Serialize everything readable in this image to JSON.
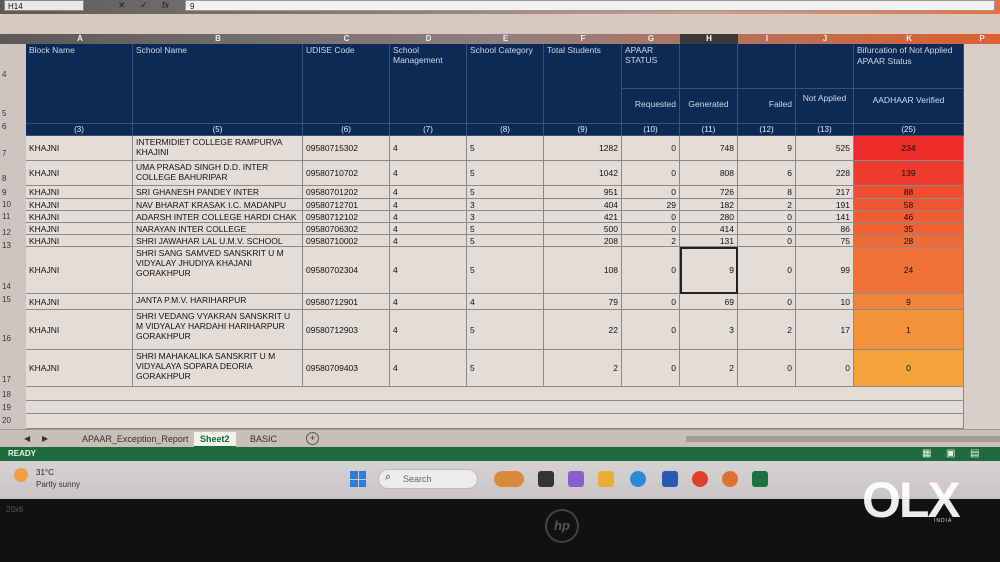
{
  "formula_bar": {
    "name_box": "H14",
    "cancel_glyph": "✕",
    "enter_glyph": "✓",
    "fx_glyph": "fx",
    "formula_value": "9"
  },
  "columns": [
    {
      "letter": "A"
    },
    {
      "letter": "B"
    },
    {
      "letter": "C"
    },
    {
      "letter": "D"
    },
    {
      "letter": "E"
    },
    {
      "letter": "F"
    },
    {
      "letter": "G"
    },
    {
      "letter": "H"
    },
    {
      "letter": "I"
    },
    {
      "letter": "J"
    },
    {
      "letter": "K"
    },
    {
      "letter": "P"
    }
  ],
  "header": {
    "block_name": "Block Name",
    "school_name": "School Name",
    "udise_code": "UDISE Code",
    "school_management": "School Management",
    "school_category": "School Category",
    "total_students": "Total Students",
    "apaar_status": "APAAR STATUS",
    "requested": "Requested",
    "generated": "Generated",
    "failed": "Failed",
    "not_applied": "Not Applied",
    "bifurcation": "Bifurcation of Not Applied APAAR Status",
    "aadhaar_verified": "AADHAAR Verified"
  },
  "header_numbers": [
    "(3)",
    "(5)",
    "(6)",
    "(7)",
    "(8)",
    "(9)",
    "(10)",
    "(11)",
    "(12)",
    "(13)",
    "(25)"
  ],
  "row_numbers": [
    "4",
    "5",
    "6",
    "7",
    "8",
    "9",
    "10",
    "11",
    "12",
    "13",
    "14",
    "15",
    "16",
    "17",
    "18",
    "19",
    "20"
  ],
  "rows": [
    {
      "block": "KHAJNI",
      "school": "INTERMIDIET COLLEGE RAMPURVA KHAJINI",
      "udise": "09580715302",
      "mgmt": "4",
      "cat": "5",
      "total": "1282",
      "requested": "0",
      "generated": "748",
      "failed": "9",
      "not_applied": "525",
      "aadhaar": "234",
      "color": "#ee2a2a"
    },
    {
      "block": "KHAJNI",
      "school": "UMA PRASAD SINGH D.D. INTER COLLEGE BAHURIPAR",
      "udise": "09580710702",
      "mgmt": "4",
      "cat": "5",
      "total": "1042",
      "requested": "0",
      "generated": "808",
      "failed": "6",
      "not_applied": "228",
      "aadhaar": "139",
      "color": "#ef3b2e"
    },
    {
      "block": "KHAJNI",
      "school": "SRI GHANESH PANDEY INTER COLLEGE",
      "udise": "09580701202",
      "mgmt": "4",
      "cat": "5",
      "total": "951",
      "requested": "0",
      "generated": "726",
      "failed": "8",
      "not_applied": "217",
      "aadhaar": "88",
      "color": "#ef4d30"
    },
    {
      "block": "KHAJNI",
      "school": "NAV BHARAT KRASAK I.C. MADANPU",
      "udise": "09580712701",
      "mgmt": "4",
      "cat": "3",
      "total": "404",
      "requested": "29",
      "generated": "182",
      "failed": "2",
      "not_applied": "191",
      "aadhaar": "58",
      "color": "#f05532"
    },
    {
      "block": "KHAJNI",
      "school": "ADARSH INTER COLLEGE HARDI CHAK",
      "udise": "09580712102",
      "mgmt": "4",
      "cat": "3",
      "total": "421",
      "requested": "0",
      "generated": "280",
      "failed": "0",
      "not_applied": "141",
      "aadhaar": "46",
      "color": "#f05c33"
    },
    {
      "block": "KHAJNI",
      "school": "NARAYAN INTER COLLEGE",
      "udise": "09580706302",
      "mgmt": "4",
      "cat": "5",
      "total": "500",
      "requested": "0",
      "generated": "414",
      "failed": "0",
      "not_applied": "86",
      "aadhaar": "35",
      "color": "#f06234"
    },
    {
      "block": "KHAJNI",
      "school": "SHRI JAWAHAR LAL U.M.V. SCHOOL",
      "udise": "09580710002",
      "mgmt": "4",
      "cat": "5",
      "total": "208",
      "requested": "2",
      "generated": "131",
      "failed": "0",
      "not_applied": "75",
      "aadhaar": "28",
      "color": "#f06a35"
    },
    {
      "block": "KHAJNI",
      "school": "SHRI SANG SAMVED SANSKRIT U M VIDYALAY JHUDIYA KHAJANI GORAKHPUR",
      "udise": "09580702304",
      "mgmt": "4",
      "cat": "5",
      "total": "108",
      "requested": "0",
      "generated": "9",
      "failed": "0",
      "not_applied": "99",
      "aadhaar": "24",
      "color": "#f07236"
    },
    {
      "block": "KHAJNI",
      "school": "JANTA P.M.V. HARIHARPUR",
      "udise": "09580712901",
      "mgmt": "4",
      "cat": "4",
      "total": "79",
      "requested": "0",
      "generated": "69",
      "failed": "0",
      "not_applied": "10",
      "aadhaar": "9",
      "color": "#f18438"
    },
    {
      "block": "KHAJNI",
      "school": "SHRI VEDANG VYAKRAN SANSKRIT U M VIDYALAY HARDAHI HARIHARPUR GORAKHPUR",
      "udise": "09580712903",
      "mgmt": "4",
      "cat": "5",
      "total": "22",
      "requested": "0",
      "generated": "3",
      "failed": "2",
      "not_applied": "17",
      "aadhaar": "1",
      "color": "#f2923a"
    },
    {
      "block": "KHAJNI",
      "school": "SHRI MAHAKALIKA SANSKRIT U M VIDYALAYA SOPARA DEORIA GORAKHPUR",
      "udise": "09580709403",
      "mgmt": "4",
      "cat": "5",
      "total": "2",
      "requested": "0",
      "generated": "2",
      "failed": "0",
      "not_applied": "0",
      "aadhaar": "0",
      "color": "#f3a23c"
    }
  ],
  "sheet_tabs": [
    {
      "label": "APAAR_Exception_Report"
    },
    {
      "label": "Sheet2"
    },
    {
      "label": "BASIC"
    }
  ],
  "add_sheet_glyph": "+",
  "status_bar": {
    "ready": "READY"
  },
  "taskbar": {
    "weather_temp": "31°C",
    "weather_desc": "Partly sunny",
    "search_icon_glyph": "⌕",
    "search_text": "Search"
  },
  "bezel_text": "20x6",
  "hp_logo": "hp",
  "watermark": {
    "logo": "OLX",
    "sub": "INDIA"
  }
}
